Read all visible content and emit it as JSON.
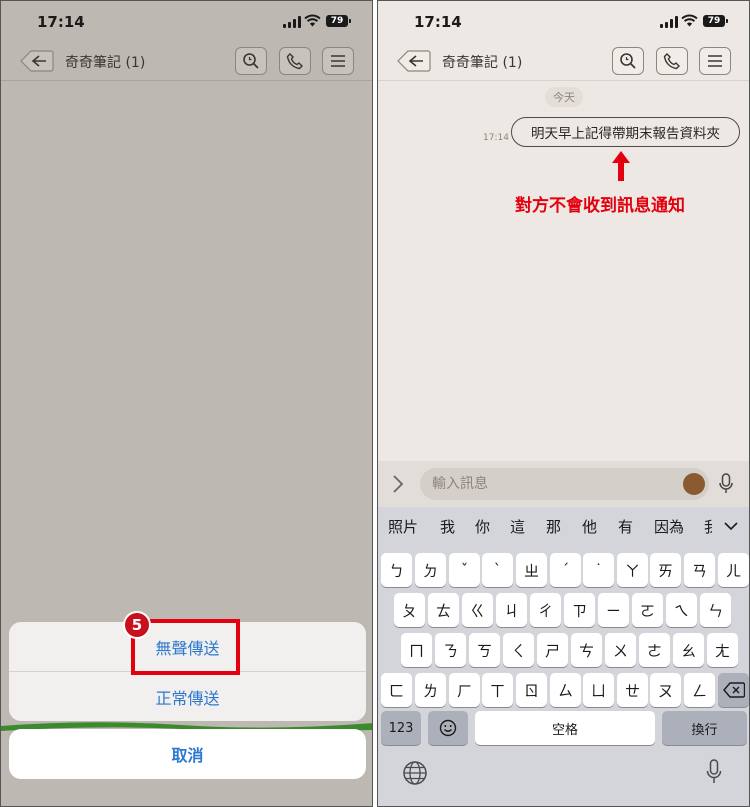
{
  "status": {
    "time": "17:14",
    "battery": "79"
  },
  "chat": {
    "title": "奇奇筆記 (1)"
  },
  "action_sheet": {
    "silent_send": "無聲傳送",
    "normal_send": "正常傳送",
    "cancel": "取消",
    "step_number": "5"
  },
  "conversation": {
    "date": "今天",
    "message_time": "17:14",
    "message_text": "明天早上記得帶期末報告資料夾",
    "annotation": "對方不會收到訊息通知"
  },
  "input": {
    "placeholder": "輸入訊息"
  },
  "keyboard": {
    "suggestions": [
      "照片",
      "我",
      "你",
      "這",
      "那",
      "他",
      "有",
      "因為",
      "我"
    ],
    "row1": [
      "ㄅ",
      "ㄉ",
      "ˇ",
      "ˋ",
      "ㄓ",
      "ˊ",
      "˙",
      "ㄚ",
      "ㄞ",
      "ㄢ",
      "ㄦ"
    ],
    "row2": [
      "ㄆ",
      "ㄊ",
      "ㄍ",
      "ㄐ",
      "ㄔ",
      "ㄗ",
      "ㄧ",
      "ㄛ",
      "ㄟ",
      "ㄣ"
    ],
    "row3": [
      "ㄇ",
      "ㄋ",
      "ㄎ",
      "ㄑ",
      "ㄕ",
      "ㄘ",
      "ㄨ",
      "ㄜ",
      "ㄠ",
      "ㄤ"
    ],
    "row4": [
      "ㄈ",
      "ㄌ",
      "ㄏ",
      "ㄒ",
      "ㄖ",
      "ㄙ",
      "ㄩ",
      "ㄝ",
      "ㄡ",
      "ㄥ"
    ],
    "numbers_key": "123",
    "space_key": "空格",
    "return_key": "換行"
  },
  "colors": {
    "accent_blue": "#2d78d0",
    "annotation_red": "#e3000f",
    "highlight_red": "#e3000f"
  }
}
